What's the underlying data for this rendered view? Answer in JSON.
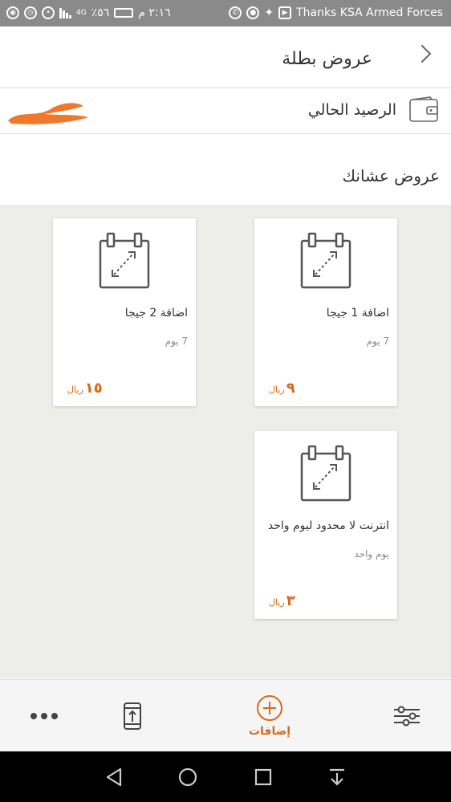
{
  "status_bar": {
    "time": "٢:١٦ م",
    "battery": "٥٦٪",
    "network": "4G",
    "notification_text": "Thanks KSA Armed Forces"
  },
  "header": {
    "title": "عروض بطلة",
    "back_icon": "chevron-right-icon"
  },
  "balance": {
    "label": "الرصيد الحالي",
    "icon": "wallet-icon"
  },
  "section": {
    "title": "عروض عشانك"
  },
  "offers": [
    {
      "title": "اضافة 1 جيجا",
      "duration": "7 يوم",
      "price": "٩",
      "currency": "ريال"
    },
    {
      "title": "اضافة 2 جيجا",
      "duration": "7 يوم",
      "price": "١٥",
      "currency": "ريال"
    },
    {
      "title": "انترنت لا محدود ليوم واحد",
      "duration": "يوم واحد",
      "price": "٣",
      "currency": "ريال"
    }
  ],
  "bottom_nav": {
    "active_label": "إضافات",
    "items": [
      "filter-icon",
      "add-circle-icon",
      "phone-upload-icon",
      "more-icon"
    ]
  },
  "colors": {
    "accent": "#d86a1a",
    "status_bar": "#8a8a8a",
    "background_grid": "#ededea"
  }
}
